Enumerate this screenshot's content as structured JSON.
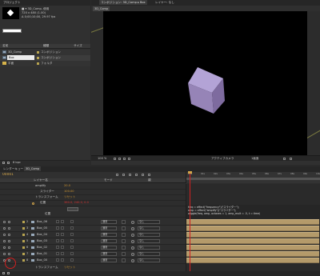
{
  "colors": {
    "accent": "#d4a64a",
    "label_orange": "#c9922f",
    "expr": "#ddd",
    "red_circle": "#d02020",
    "layer_bar": "#b49a6a",
    "cube": "#9a86bf"
  },
  "project": {
    "tab": "プロジェクト",
    "info": [
      "720 x 480 (1.00)",
      "Δ 0;00;10;00, 29.97 fps"
    ],
    "columns": {
      "name": "名前",
      "type": "種類",
      "size": "サイズ"
    },
    "items": [
      {
        "name": "3D_Comp",
        "type": "コンポジション",
        "icon": "composition-icon"
      },
      {
        "name": "Box",
        "type": "コンポジション",
        "icon": "composition-icon"
      },
      {
        "name": "平面",
        "type": "フォルダ",
        "icon": "folder-icon"
      }
    ],
    "footer": "8 bpc"
  },
  "composition": {
    "tab": "コンポジション: 3D_Comp",
    "tab_b": "Box",
    "subtab": "3D_Comp",
    "second_tab": "レイヤー: なし",
    "footer": {
      "zoom": "100 %",
      "camera": "アクティブカメラ",
      "view": "1画面"
    }
  },
  "timeline": {
    "tabs": [
      "レンダーキュー",
      "3D_Comp"
    ],
    "time": "00001",
    "col_layer": "レイヤー名",
    "col_parent": "親",
    "col_mode": "モード",
    "props": [
      {
        "name": "amplify",
        "value": "20.0",
        "indent": 1
      },
      {
        "name": "スライダー",
        "value": "100.00",
        "indent": 2
      },
      {
        "name": "トランスフォーム",
        "value": "リセット",
        "indent": 1
      },
      {
        "name": "位置",
        "value": "360.0, 240.0, 0.0",
        "indent": 2
      },
      {
        "name": "位置",
        "value": "",
        "indent": 2
      }
    ],
    "expression": [
      "freq = effect(\"frequency\")(\"スライダー\");",
      "amp = effect(\"amplify\")(\"スライダー\");",
      "wiggle(freq, amp, octaves = 1, amp_mult = .5, t = time)"
    ],
    "layers": [
      "Box_06",
      "Box_05",
      "Box_04",
      "Box_03",
      "Box_02",
      "Box_01",
      "Box_00"
    ],
    "layer_mode": "通常",
    "layer_parent": "なし",
    "bottom_row": {
      "name": "トランスフォーム",
      "value": "リセット"
    },
    "ruler": [
      "00s",
      "01s",
      "02s",
      "03s",
      "04s",
      "05s",
      "06s",
      "07s",
      "08s",
      "09s",
      "10s"
    ]
  }
}
